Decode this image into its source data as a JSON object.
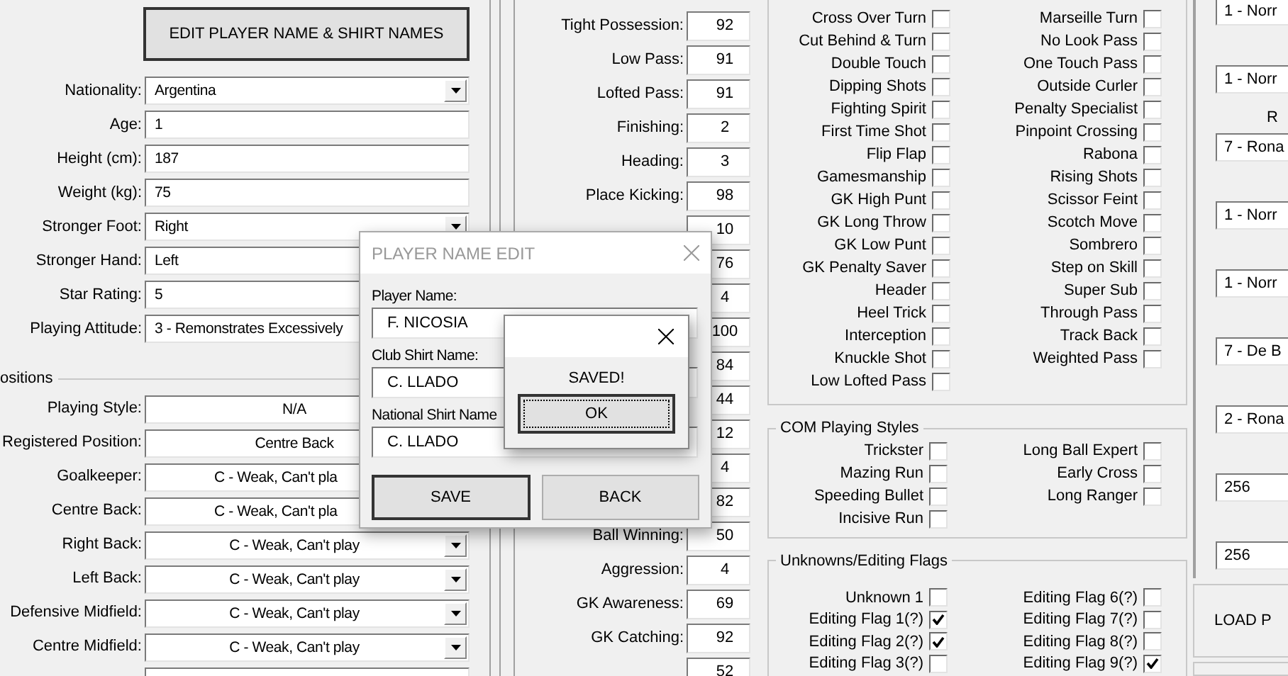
{
  "left_panel": {
    "edit_button": "EDIT PLAYER NAME & SHIRT NAMES",
    "fields": [
      {
        "label": "Nationality:",
        "value": "Argentina",
        "kind": "dropdown"
      },
      {
        "label": "Age:",
        "value": "1",
        "kind": "text"
      },
      {
        "label": "Height (cm):",
        "value": "187",
        "kind": "text"
      },
      {
        "label": "Weight (kg):",
        "value": "75",
        "kind": "text"
      },
      {
        "label": "Stronger Foot:",
        "value": "Right",
        "kind": "dropdown"
      },
      {
        "label": "Stronger Hand:",
        "value": "Left",
        "kind": "text"
      },
      {
        "label": "Star Rating:",
        "value": "5",
        "kind": "text"
      },
      {
        "label": "Playing Attitude:",
        "value": "3 - Remonstrates Excessively",
        "kind": "text"
      }
    ],
    "positions": {
      "title": "ositions",
      "rows": [
        {
          "label": "Playing Style:",
          "value": "N/A",
          "kind": "text"
        },
        {
          "label": "Registered Position:",
          "value": "Centre Back",
          "kind": "text"
        },
        {
          "label": "Goalkeeper:",
          "value": "C - Weak, Can't pla",
          "kind": "covered"
        },
        {
          "label": "Centre Back:",
          "value": "C - Weak, Can't pla",
          "kind": "covered"
        },
        {
          "label": "Right Back:",
          "value": "C - Weak, Can't play",
          "kind": "dropdown"
        },
        {
          "label": "Left Back:",
          "value": "C - Weak, Can't play",
          "kind": "dropdown"
        },
        {
          "label": "Defensive Midfield:",
          "value": "C - Weak, Can't play",
          "kind": "dropdown"
        },
        {
          "label": "Centre Midfield:",
          "value": "C - Weak, Can't play",
          "kind": "dropdown"
        }
      ]
    }
  },
  "stats": [
    {
      "label": "Tight Possession:",
      "value": "92"
    },
    {
      "label": "Low Pass:",
      "value": "91"
    },
    {
      "label": "Lofted Pass:",
      "value": "91"
    },
    {
      "label": "Finishing:",
      "value": "2"
    },
    {
      "label": "Heading:",
      "value": "3"
    },
    {
      "label": "Place Kicking:",
      "value": "98"
    },
    {
      "value": "10"
    },
    {
      "value": "76"
    },
    {
      "value": "4"
    },
    {
      "value": "100"
    },
    {
      "value": "84"
    },
    {
      "value": "44"
    },
    {
      "value": "12"
    },
    {
      "value": "4"
    },
    {
      "value": "82"
    },
    {
      "label": "Ball Winning:",
      "value": "50"
    },
    {
      "label": "Aggression:",
      "value": "4"
    },
    {
      "label": "GK Awareness:",
      "value": "69"
    },
    {
      "label": "GK Catching:",
      "value": "92"
    },
    {
      "value": "52"
    }
  ],
  "skills": {
    "left": [
      {
        "label": "Cross Over Turn",
        "checked": false
      },
      {
        "label": "Cut Behind & Turn",
        "checked": false
      },
      {
        "label": "Double Touch",
        "checked": false
      },
      {
        "label": "Dipping Shots",
        "checked": false
      },
      {
        "label": "Fighting Spirit",
        "checked": false
      },
      {
        "label": "First Time Shot",
        "checked": false
      },
      {
        "label": "Flip Flap",
        "checked": false
      },
      {
        "label": "Gamesmanship",
        "checked": false
      },
      {
        "label": "GK High Punt",
        "checked": false
      },
      {
        "label": "GK Long Throw",
        "checked": false
      },
      {
        "label": "GK Low Punt",
        "checked": false
      },
      {
        "label": "GK Penalty Saver",
        "checked": false
      },
      {
        "label": "Header",
        "checked": false
      },
      {
        "label": "Heel Trick",
        "checked": false
      },
      {
        "label": "Interception",
        "checked": false
      },
      {
        "label": "Knuckle Shot",
        "checked": false
      },
      {
        "label": "Low Lofted Pass",
        "checked": false
      }
    ],
    "right": [
      {
        "label": "Marseille Turn",
        "checked": false
      },
      {
        "label": "No Look Pass",
        "checked": false
      },
      {
        "label": "One Touch Pass",
        "checked": false
      },
      {
        "label": "Outside Curler",
        "checked": false
      },
      {
        "label": "Penalty Specialist",
        "checked": false
      },
      {
        "label": "Pinpoint Crossing",
        "checked": false
      },
      {
        "label": "Rabona",
        "checked": false
      },
      {
        "label": "Rising Shots",
        "checked": false
      },
      {
        "label": "Scissor Feint",
        "checked": false
      },
      {
        "label": "Scotch Move",
        "checked": false
      },
      {
        "label": "Sombrero",
        "checked": false
      },
      {
        "label": "Step on Skill",
        "checked": false
      },
      {
        "label": "Super Sub",
        "checked": false
      },
      {
        "label": "Through Pass",
        "checked": false
      },
      {
        "label": "Track Back",
        "checked": false
      },
      {
        "label": "Weighted Pass",
        "checked": false
      }
    ]
  },
  "com_styles": {
    "title": "COM Playing Styles",
    "left": [
      {
        "label": "Trickster",
        "checked": false
      },
      {
        "label": "Mazing Run",
        "checked": false
      },
      {
        "label": "Speeding Bullet",
        "checked": false
      },
      {
        "label": "Incisive Run",
        "checked": false
      }
    ],
    "right": [
      {
        "label": "Long Ball Expert",
        "checked": false
      },
      {
        "label": "Early Cross",
        "checked": false
      },
      {
        "label": "Long Ranger",
        "checked": false
      }
    ]
  },
  "flags": {
    "title": "Unknowns/Editing Flags",
    "left": [
      {
        "label": "Unknown 1",
        "checked": false
      },
      {
        "label": "Editing Flag 1(?)",
        "checked": true
      },
      {
        "label": "Editing Flag 2(?)",
        "checked": true
      },
      {
        "label": "Editing Flag 3(?)",
        "checked": false
      }
    ],
    "right": [
      {
        "label": "Editing Flag 6(?)",
        "checked": false
      },
      {
        "label": "Editing Flag 7(?)",
        "checked": false
      },
      {
        "label": "Editing Flag 8(?)",
        "checked": false
      },
      {
        "label": "Editing Flag 9(?)",
        "checked": true
      }
    ]
  },
  "right_panel": {
    "items": [
      {
        "kind": "field",
        "text": "1 - Norr"
      },
      {
        "kind": "field",
        "text": "1 - Norr"
      },
      {
        "kind": "label",
        "text": "R"
      },
      {
        "kind": "field",
        "text": "7 - Rona"
      },
      {
        "kind": "field",
        "text": "1 - Norr"
      },
      {
        "kind": "field",
        "text": "1 - Norr"
      },
      {
        "kind": "field",
        "text": "7 - De B"
      },
      {
        "kind": "field",
        "text": "2 - Rona"
      },
      {
        "kind": "field",
        "text": "256"
      },
      {
        "kind": "field",
        "text": "256"
      }
    ],
    "button": "LOAD P"
  },
  "name_dialog": {
    "title": "PLAYER NAME EDIT",
    "fields": [
      {
        "label": "Player Name:",
        "value": "F. NICOSIA"
      },
      {
        "label": "Club Shirt Name:",
        "value": "C. LLADO"
      },
      {
        "label": "National Shirt Name",
        "value": "C. LLADO"
      }
    ],
    "buttons": [
      "SAVE",
      "BACK"
    ]
  },
  "alert": {
    "message": "SAVED!",
    "button": "OK"
  }
}
